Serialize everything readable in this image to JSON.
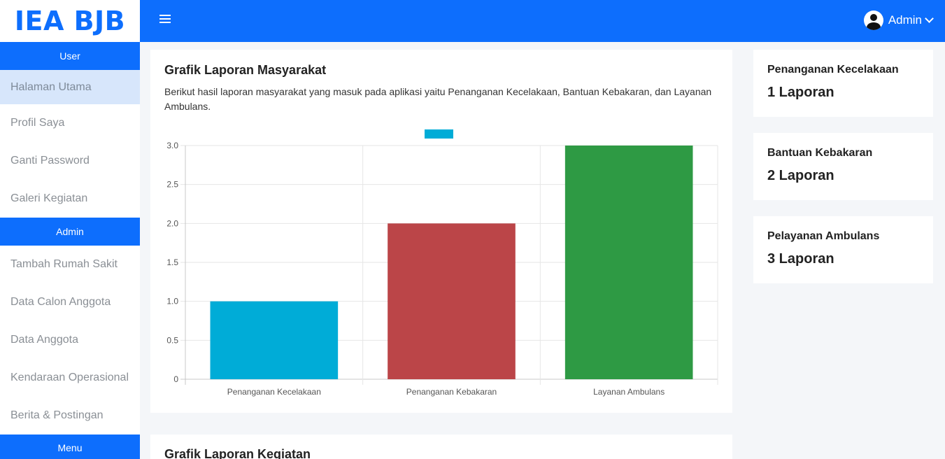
{
  "brand": "IEA BJB",
  "sidebar": {
    "user_header": "User",
    "user_items": [
      "Halaman Utama",
      "Profil Saya",
      "Ganti Password",
      "Galeri Kegiatan"
    ],
    "admin_header": "Admin",
    "admin_items": [
      "Tambah Rumah Sakit",
      "Data Calon Anggota",
      "Data Anggota",
      "Kendaraan Operasional",
      "Berita & Postingan"
    ],
    "menu_header": "Menu"
  },
  "topbar": {
    "user_name": "Admin"
  },
  "report_chart": {
    "title": "Grafik Laporan Masyarakat",
    "description": "Berikut hasil laporan masyarakat yang masuk pada aplikasi yaitu Penanganan Kecelakaan, Bantuan Kebakaran, dan Layanan Ambulans."
  },
  "chart_data": {
    "type": "bar",
    "categories": [
      "Penanganan Kecelakaan",
      "Penanganan Kebakaran",
      "Layanan Ambulans"
    ],
    "values": [
      1,
      2,
      3
    ],
    "colors": [
      "#00acd7",
      "#bb4548",
      "#2e9a44"
    ],
    "legend_color": "#00acd7",
    "legend_placement": "top-center",
    "y_ticks": [
      "0",
      "0.5",
      "1.0",
      "1.5",
      "2.0",
      "2.5",
      "3.0"
    ],
    "ylim": [
      0,
      3
    ],
    "grid": true
  },
  "activity_chart": {
    "title": "Grafik Laporan Kegiatan"
  },
  "stats": [
    {
      "label": "Penanganan Kecelakaan",
      "count": "1 Laporan"
    },
    {
      "label": "Bantuan Kebakaran",
      "count": "2 Laporan"
    },
    {
      "label": "Pelayanan Ambulans",
      "count": "3 Laporan"
    }
  ]
}
